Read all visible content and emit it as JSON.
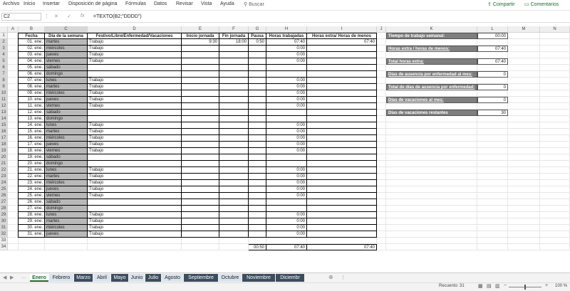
{
  "menu": [
    "Archivo",
    "Inicio",
    "Insertar",
    "Disposición de página",
    "Fórmulas",
    "Datos",
    "Revisar",
    "Vista",
    "Ayuda"
  ],
  "search": {
    "label": "Buscar"
  },
  "share_label": "Compartir",
  "comments_label": "Comentarios",
  "namebox": "C2",
  "formula": "=TEXTO(B2;\"DDDD\")",
  "fx_label": "fx",
  "columns": [
    "A",
    "B",
    "C",
    "D",
    "E",
    "F",
    "G",
    "H",
    "I",
    "J",
    "K",
    "L",
    "M",
    "N"
  ],
  "headers": {
    "fecha": "Fecha",
    "dia": "Día de la semana",
    "festivo": "Festivo/Libre/Enfermedad/Vacaciones",
    "inicio": "Inicio jornada",
    "fin": "Fin jornada",
    "pausa": "Pausa",
    "horas": "Horas trabajadas",
    "extra": "Horas extra/ Horas de menos"
  },
  "rows": [
    {
      "fecha": "01. ene.",
      "dia": "martes",
      "festivo": "Trabajo",
      "inicio": "9:30",
      "fin": "18:00",
      "pausa": "0:50",
      "horas": "07:40",
      "extra": "07:40"
    },
    {
      "fecha": "02. ene.",
      "dia": "miércoles",
      "festivo": "Trabajo",
      "horas": "0:00"
    },
    {
      "fecha": "03. ene.",
      "dia": "jueves",
      "festivo": "Trabajo",
      "horas": "0:00"
    },
    {
      "fecha": "04. ene.",
      "dia": "viernes",
      "festivo": "Trabajo",
      "horas": "0:00"
    },
    {
      "fecha": "05. ene.",
      "dia": "sábado"
    },
    {
      "fecha": "06. ene.",
      "dia": "domingo"
    },
    {
      "fecha": "07. ene.",
      "dia": "lunes",
      "festivo": "Trabajo",
      "horas": "0:00"
    },
    {
      "fecha": "08. ene.",
      "dia": "martes",
      "festivo": "Trabajo",
      "horas": "0:00"
    },
    {
      "fecha": "09. ene.",
      "dia": "miércoles",
      "festivo": "Trabajo",
      "horas": "0:00"
    },
    {
      "fecha": "10. ene.",
      "dia": "jueves",
      "festivo": "Trabajo",
      "horas": "0:00"
    },
    {
      "fecha": "11. ene.",
      "dia": "viernes",
      "festivo": "Trabajo",
      "horas": "0:00"
    },
    {
      "fecha": "12. ene.",
      "dia": "sábado"
    },
    {
      "fecha": "13. ene.",
      "dia": "domingo"
    },
    {
      "fecha": "14. ene.",
      "dia": "lunes",
      "festivo": "Trabajo",
      "horas": "0:00"
    },
    {
      "fecha": "15. ene.",
      "dia": "martes",
      "festivo": "Trabajo",
      "horas": "0:00"
    },
    {
      "fecha": "16. ene.",
      "dia": "miércoles",
      "festivo": "Trabajo",
      "horas": "0:00"
    },
    {
      "fecha": "17. ene.",
      "dia": "jueves",
      "festivo": "Trabajo",
      "horas": "0:00"
    },
    {
      "fecha": "18. ene.",
      "dia": "viernes",
      "festivo": "Trabajo",
      "horas": "0:00"
    },
    {
      "fecha": "19. ene.",
      "dia": "sábado"
    },
    {
      "fecha": "20. ene.",
      "dia": "domingo"
    },
    {
      "fecha": "21. ene.",
      "dia": "lunes",
      "festivo": "Trabajo",
      "horas": "0:00"
    },
    {
      "fecha": "22. ene.",
      "dia": "martes",
      "festivo": "Trabajo",
      "horas": "0:00"
    },
    {
      "fecha": "23. ene.",
      "dia": "miércoles",
      "festivo": "Trabajo",
      "horas": "0:00"
    },
    {
      "fecha": "24. ene.",
      "dia": "jueves",
      "festivo": "Trabajo",
      "horas": "0:00"
    },
    {
      "fecha": "25. ene.",
      "dia": "viernes",
      "festivo": "Trabajo",
      "horas": "0:00"
    },
    {
      "fecha": "26. ene.",
      "dia": "sábado"
    },
    {
      "fecha": "27. ene.",
      "dia": "domingo"
    },
    {
      "fecha": "28. ene.",
      "dia": "lunes",
      "festivo": "Trabajo",
      "horas": "0:00"
    },
    {
      "fecha": "29. ene.",
      "dia": "martes",
      "festivo": "Trabajo",
      "horas": "0:00"
    },
    {
      "fecha": "30. ene.",
      "dia": "miércoles",
      "festivo": "Trabajo",
      "horas": "0:00"
    },
    {
      "fecha": "31. ene.",
      "dia": "jueves",
      "festivo": "Trabajo",
      "horas": "0:00"
    }
  ],
  "row_numbers": [
    "1",
    "2",
    "3",
    "4",
    "5",
    "6",
    "7",
    "8",
    "9",
    "10",
    "11",
    "12",
    "13",
    "14",
    "15",
    "16",
    "17",
    "18",
    "19",
    "20",
    "21",
    "22",
    "23",
    "24",
    "25",
    "26",
    "27",
    "28",
    "29",
    "30",
    "31",
    "32",
    "33",
    "34"
  ],
  "totals": {
    "pausa": "00:50",
    "horas": "07:40",
    "extra": "07:40"
  },
  "summary": [
    {
      "label": "Tiempo de trabajo semanal:",
      "value": "00:00",
      "underline": false
    },
    {
      "label": "Horas extra / horas de menos:",
      "value": "07:40",
      "underline": true
    },
    {
      "label": "Total  horas extra:",
      "value": "07:40",
      "underline": true
    },
    {
      "label": "Días de ausencia por enfermedad al mes:",
      "value": "0",
      "underline": true
    },
    {
      "label": "Total de días de ausencia por enfermedad:",
      "value": "0",
      "underline": true
    },
    {
      "label": "Días de vacaciones al mes:",
      "value": "0",
      "underline": true
    },
    {
      "label": "Días de vacaciones restantes",
      "value": "30",
      "underline": false
    }
  ],
  "tabs": [
    {
      "label": "Enero",
      "style": "active"
    },
    {
      "label": "Febrero",
      "style": "light"
    },
    {
      "label": "Marzo",
      "style": "dark"
    },
    {
      "label": "Abril",
      "style": "light"
    },
    {
      "label": "Mayo",
      "style": "dark"
    },
    {
      "label": "Junio",
      "style": "light"
    },
    {
      "label": "Julio",
      "style": "dark"
    },
    {
      "label": "Agosto",
      "style": "light"
    },
    {
      "label": "Septiembre",
      "style": "dark"
    },
    {
      "label": "Octubre",
      "style": "light"
    },
    {
      "label": "Noviembre",
      "style": "dark"
    },
    {
      "label": "Diciembr",
      "style": "dark"
    }
  ],
  "status": {
    "count": "Recuento: 31",
    "zoom": "100 %"
  },
  "colors": {
    "accent": "#1c6b2f",
    "weekend": "#bfbfbf",
    "label_bg": "#7f7f7f",
    "tab_dark": "#3d4d5e"
  }
}
